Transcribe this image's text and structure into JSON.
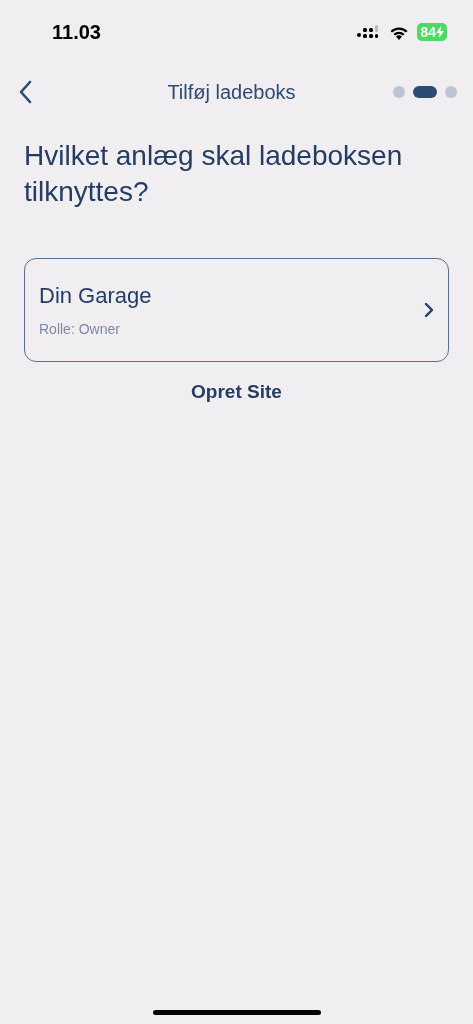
{
  "status_bar": {
    "time": "11.03",
    "battery": "84",
    "charging": true
  },
  "nav": {
    "title": "Tilføj ladeboks",
    "steps": [
      {
        "selected": false
      },
      {
        "selected": true
      },
      {
        "selected": false
      }
    ]
  },
  "heading": "Hvilket anlæg skal ladeboksen tilknyttes?",
  "sites": [
    {
      "name": "Din Garage",
      "role": "Rolle: Owner"
    }
  ],
  "create_link": "Opret Site"
}
